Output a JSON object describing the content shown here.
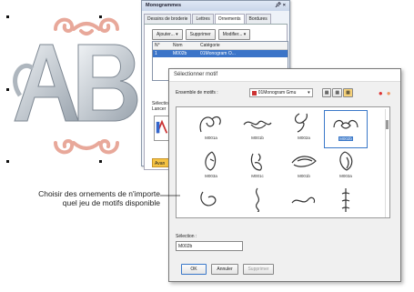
{
  "panel": {
    "title": "Monogrammes",
    "pin_icon": "pin-icon",
    "close_symbol": "×",
    "tabs": [
      "Dessins de broderie",
      "Lettres",
      "Ornements",
      "Bordures"
    ],
    "buttons": {
      "add": "Ajouter...",
      "remove": "Supprimer",
      "modify": "Modifier..."
    },
    "columns": [
      "N°",
      "Nom",
      "Catégorie"
    ],
    "row": {
      "num": "1",
      "name": "M002b",
      "category": "01Monogram O..."
    },
    "cut_labels": [
      "Sélectio",
      "Lancer"
    ],
    "bottom_label": "Avan"
  },
  "dialog": {
    "title": "Sélectionner motif",
    "set_label": "Ensemble de motifs :",
    "set_value": "01Monogram Gmu",
    "motifs": [
      "M001a",
      "M001b",
      "M002a",
      "M002b",
      "M003a",
      "M001c",
      "M001b",
      "M003a",
      "",
      "",
      "",
      ""
    ],
    "selected_index": 3,
    "selection_label": "Sélection :",
    "selection_value": "M002b",
    "ok": "OK",
    "cancel": "Annuler",
    "delete": "Supprimer"
  },
  "callout": "Choisir des ornements de n'importe quel jeu de motifs disponible"
}
